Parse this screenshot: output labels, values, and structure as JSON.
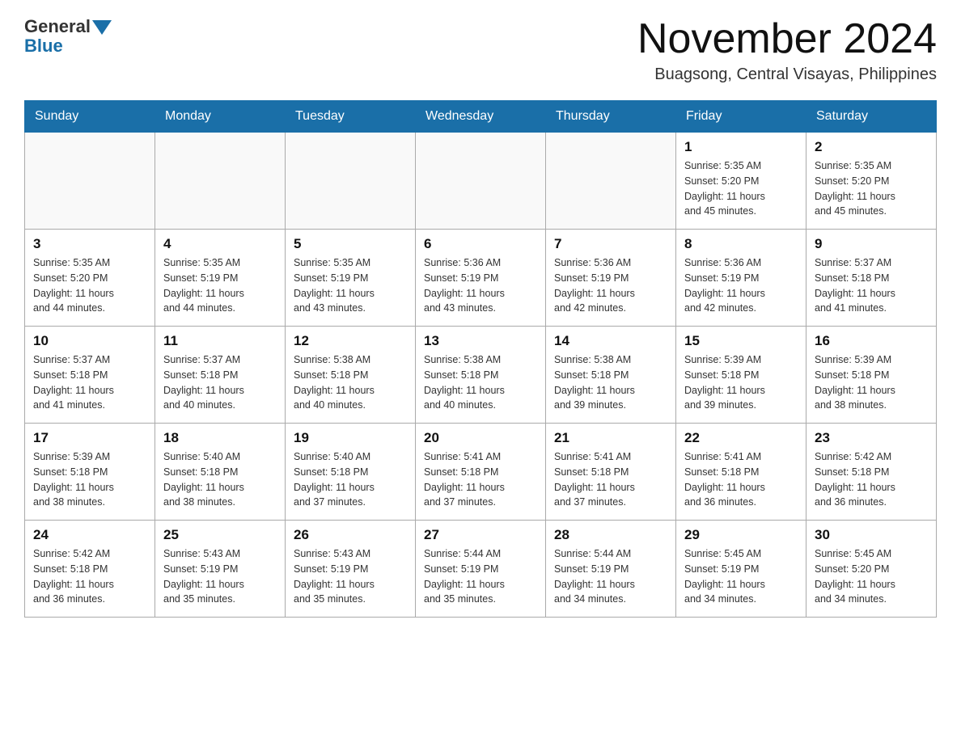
{
  "logo": {
    "general": "General",
    "blue": "Blue",
    "arrow": "▶"
  },
  "title": "November 2024",
  "subtitle": "Buagsong, Central Visayas, Philippines",
  "days_header": [
    "Sunday",
    "Monday",
    "Tuesday",
    "Wednesday",
    "Thursday",
    "Friday",
    "Saturday"
  ],
  "weeks": [
    [
      {
        "day": "",
        "info": ""
      },
      {
        "day": "",
        "info": ""
      },
      {
        "day": "",
        "info": ""
      },
      {
        "day": "",
        "info": ""
      },
      {
        "day": "",
        "info": ""
      },
      {
        "day": "1",
        "info": "Sunrise: 5:35 AM\nSunset: 5:20 PM\nDaylight: 11 hours\nand 45 minutes."
      },
      {
        "day": "2",
        "info": "Sunrise: 5:35 AM\nSunset: 5:20 PM\nDaylight: 11 hours\nand 45 minutes."
      }
    ],
    [
      {
        "day": "3",
        "info": "Sunrise: 5:35 AM\nSunset: 5:20 PM\nDaylight: 11 hours\nand 44 minutes."
      },
      {
        "day": "4",
        "info": "Sunrise: 5:35 AM\nSunset: 5:19 PM\nDaylight: 11 hours\nand 44 minutes."
      },
      {
        "day": "5",
        "info": "Sunrise: 5:35 AM\nSunset: 5:19 PM\nDaylight: 11 hours\nand 43 minutes."
      },
      {
        "day": "6",
        "info": "Sunrise: 5:36 AM\nSunset: 5:19 PM\nDaylight: 11 hours\nand 43 minutes."
      },
      {
        "day": "7",
        "info": "Sunrise: 5:36 AM\nSunset: 5:19 PM\nDaylight: 11 hours\nand 42 minutes."
      },
      {
        "day": "8",
        "info": "Sunrise: 5:36 AM\nSunset: 5:19 PM\nDaylight: 11 hours\nand 42 minutes."
      },
      {
        "day": "9",
        "info": "Sunrise: 5:37 AM\nSunset: 5:18 PM\nDaylight: 11 hours\nand 41 minutes."
      }
    ],
    [
      {
        "day": "10",
        "info": "Sunrise: 5:37 AM\nSunset: 5:18 PM\nDaylight: 11 hours\nand 41 minutes."
      },
      {
        "day": "11",
        "info": "Sunrise: 5:37 AM\nSunset: 5:18 PM\nDaylight: 11 hours\nand 40 minutes."
      },
      {
        "day": "12",
        "info": "Sunrise: 5:38 AM\nSunset: 5:18 PM\nDaylight: 11 hours\nand 40 minutes."
      },
      {
        "day": "13",
        "info": "Sunrise: 5:38 AM\nSunset: 5:18 PM\nDaylight: 11 hours\nand 40 minutes."
      },
      {
        "day": "14",
        "info": "Sunrise: 5:38 AM\nSunset: 5:18 PM\nDaylight: 11 hours\nand 39 minutes."
      },
      {
        "day": "15",
        "info": "Sunrise: 5:39 AM\nSunset: 5:18 PM\nDaylight: 11 hours\nand 39 minutes."
      },
      {
        "day": "16",
        "info": "Sunrise: 5:39 AM\nSunset: 5:18 PM\nDaylight: 11 hours\nand 38 minutes."
      }
    ],
    [
      {
        "day": "17",
        "info": "Sunrise: 5:39 AM\nSunset: 5:18 PM\nDaylight: 11 hours\nand 38 minutes."
      },
      {
        "day": "18",
        "info": "Sunrise: 5:40 AM\nSunset: 5:18 PM\nDaylight: 11 hours\nand 38 minutes."
      },
      {
        "day": "19",
        "info": "Sunrise: 5:40 AM\nSunset: 5:18 PM\nDaylight: 11 hours\nand 37 minutes."
      },
      {
        "day": "20",
        "info": "Sunrise: 5:41 AM\nSunset: 5:18 PM\nDaylight: 11 hours\nand 37 minutes."
      },
      {
        "day": "21",
        "info": "Sunrise: 5:41 AM\nSunset: 5:18 PM\nDaylight: 11 hours\nand 37 minutes."
      },
      {
        "day": "22",
        "info": "Sunrise: 5:41 AM\nSunset: 5:18 PM\nDaylight: 11 hours\nand 36 minutes."
      },
      {
        "day": "23",
        "info": "Sunrise: 5:42 AM\nSunset: 5:18 PM\nDaylight: 11 hours\nand 36 minutes."
      }
    ],
    [
      {
        "day": "24",
        "info": "Sunrise: 5:42 AM\nSunset: 5:18 PM\nDaylight: 11 hours\nand 36 minutes."
      },
      {
        "day": "25",
        "info": "Sunrise: 5:43 AM\nSunset: 5:19 PM\nDaylight: 11 hours\nand 35 minutes."
      },
      {
        "day": "26",
        "info": "Sunrise: 5:43 AM\nSunset: 5:19 PM\nDaylight: 11 hours\nand 35 minutes."
      },
      {
        "day": "27",
        "info": "Sunrise: 5:44 AM\nSunset: 5:19 PM\nDaylight: 11 hours\nand 35 minutes."
      },
      {
        "day": "28",
        "info": "Sunrise: 5:44 AM\nSunset: 5:19 PM\nDaylight: 11 hours\nand 34 minutes."
      },
      {
        "day": "29",
        "info": "Sunrise: 5:45 AM\nSunset: 5:19 PM\nDaylight: 11 hours\nand 34 minutes."
      },
      {
        "day": "30",
        "info": "Sunrise: 5:45 AM\nSunset: 5:20 PM\nDaylight: 11 hours\nand 34 minutes."
      }
    ]
  ]
}
